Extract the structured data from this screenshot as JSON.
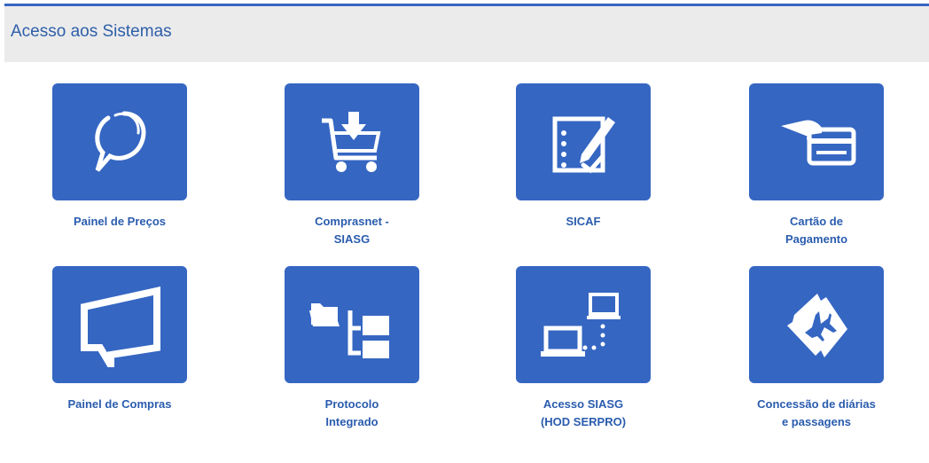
{
  "panel": {
    "title": "Acesso aos Sistemas"
  },
  "tiles": [
    {
      "icon": "search-bubble-icon",
      "label": [
        "Painel de Preços"
      ]
    },
    {
      "icon": "shopping-cart-download-icon",
      "label": [
        "Comprasnet -",
        "SIASG"
      ]
    },
    {
      "icon": "checklist-pen-icon",
      "label": [
        "SICAF"
      ]
    },
    {
      "icon": "hand-card-icon",
      "label": [
        "Cartão de",
        "Pagamento"
      ]
    },
    {
      "icon": "monitor-frame-icon",
      "label": [
        "Painel de Compras"
      ]
    },
    {
      "icon": "folder-tree-icon",
      "label": [
        "Protocolo",
        "Integrado"
      ]
    },
    {
      "icon": "networked-computers-icon",
      "label": [
        "Acesso SIASG",
        "(HOD SERPRO)"
      ]
    },
    {
      "icon": "airplane-ticket-icon",
      "label": [
        "Concessão de diárias",
        "e passagens"
      ]
    }
  ],
  "colors": {
    "tile": "#3566c2",
    "label": "#2a5cae",
    "header_bg": "#ebebec",
    "header_border": "#3566c2"
  }
}
